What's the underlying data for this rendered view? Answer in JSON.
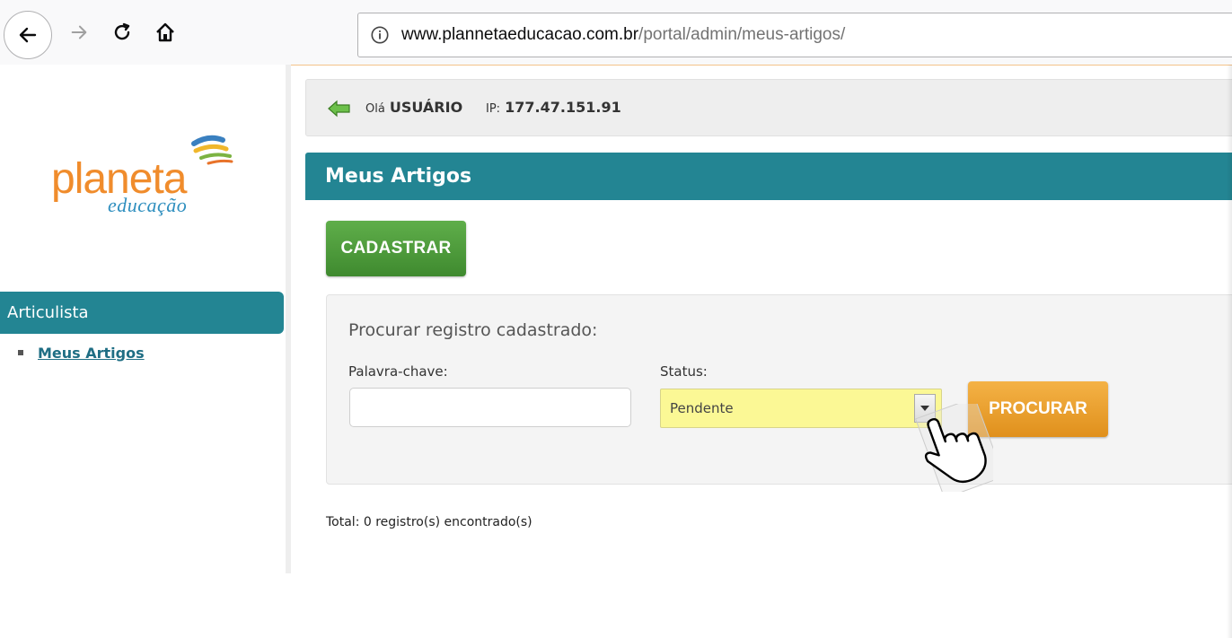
{
  "browser": {
    "url_host": "www.plannetaeducacao.com.br",
    "url_path": "/portal/admin/meus-artigos/",
    "icons": [
      "back-icon",
      "forward-icon",
      "reload-icon",
      "home-icon",
      "info-icon"
    ]
  },
  "logo": {
    "word": "planeta",
    "sub": "educação"
  },
  "sidebar": {
    "header": "Articulista",
    "items": [
      {
        "label": "Meus Artigos"
      }
    ]
  },
  "user_bar": {
    "greeting_prefix": "Olá",
    "user_name": "USUÁRIO",
    "ip_label": "IP:",
    "ip_value": "177.47.151.91"
  },
  "main": {
    "title": "Meus Artigos",
    "cadastrar_label": "CADASTRAR",
    "search": {
      "title": "Procurar registro cadastrado:",
      "keyword_label": "Palavra-chave:",
      "keyword_value": "",
      "status_label": "Status:",
      "status_value": "Pendente",
      "submit_label": "PROCURAR"
    },
    "total_text": "Total: 0 registro(s) encontrado(s)"
  },
  "colors": {
    "teal": "#238593",
    "green_button": "#4e9d3c",
    "orange_button": "#e9a12f",
    "select_highlight": "#fbf895",
    "logo_orange": "#f08c2c",
    "logo_blue": "#2f8fbf"
  }
}
